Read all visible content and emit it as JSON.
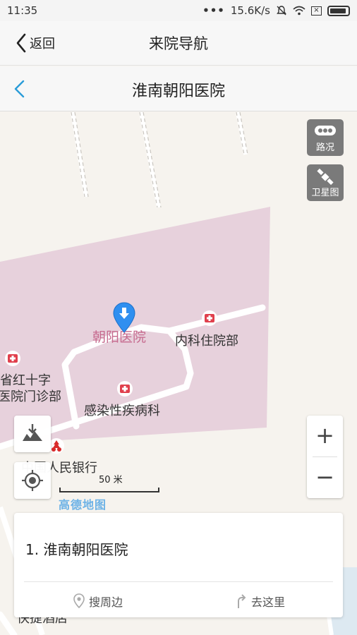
{
  "status": {
    "time": "11:35",
    "signal_dots": "•••",
    "net_speed": "15.6K/s",
    "icons": [
      "mute-icon",
      "wifi-icon",
      "close-box-icon",
      "battery-icon"
    ]
  },
  "nav": {
    "back_label": "返回",
    "title": "来院导航"
  },
  "subnav": {
    "title": "淮南朝阳医院"
  },
  "map": {
    "traffic_label": "路况",
    "satellite_label": "卫星图",
    "zoom_in": "+",
    "zoom_out": "−",
    "scale_label": "50 米",
    "brand": "高德地图",
    "pois": {
      "hospital_main": "朝阳医院",
      "inpatient": "内科住院部",
      "red_cross_line1": "省红十字",
      "red_cross_line2": "医院门诊部",
      "infectious": "感染性疾病科",
      "bank": "中国人民银行",
      "hotel": "快捷酒店"
    }
  },
  "result_card": {
    "item": "1. 淮南朝阳医院",
    "search_nearby": "搜周边",
    "go_here": "去这里"
  }
}
